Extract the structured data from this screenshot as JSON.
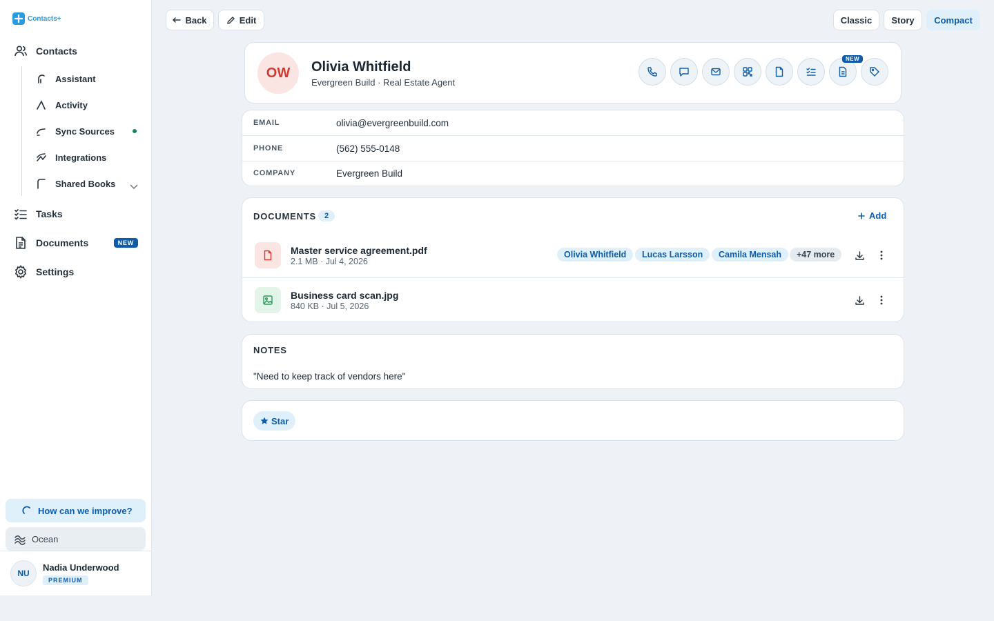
{
  "app": {
    "name": "Contacts+"
  },
  "sidebar": {
    "contacts_label": "Contacts",
    "sub_items": [
      {
        "label": "Assistant"
      },
      {
        "label": "Activity"
      },
      {
        "label": "Sync Sources"
      },
      {
        "label": "Integrations"
      },
      {
        "label": "Shared Books"
      }
    ],
    "tasks_label": "Tasks",
    "documents_label": "Documents",
    "documents_badge": "NEW",
    "settings_label": "Settings",
    "improve_label": "How can we improve?",
    "theme_label": "Ocean",
    "user": {
      "initials": "NU",
      "name": "Nadia Underwood",
      "plan": "PREMIUM"
    }
  },
  "toolbar": {
    "back_label": "Back",
    "edit_label": "Edit",
    "views": [
      {
        "label": "Classic",
        "active": false
      },
      {
        "label": "Story",
        "active": false
      },
      {
        "label": "Compact",
        "active": true
      }
    ]
  },
  "contact": {
    "initials": "OW",
    "name": "Olivia Whitfield",
    "subtitle": "Evergreen Build · Real Estate Agent",
    "actions": [
      "phone-icon",
      "chat-icon",
      "mail-icon",
      "qr-icon",
      "file-icon",
      "checklist-icon",
      "note-icon",
      "tag-icon"
    ],
    "new_flag": "NEW",
    "fields": [
      {
        "label": "EMAIL",
        "value": "olivia@evergreenbuild.com"
      },
      {
        "label": "PHONE",
        "value": "(562) 555-0148"
      },
      {
        "label": "COMPANY",
        "value": "Evergreen Build"
      }
    ]
  },
  "documents": {
    "title": "DOCUMENTS",
    "count": "2",
    "add_label": "Add",
    "items": [
      {
        "name": "Master service agreement.pdf",
        "meta": "2.1 MB · Jul 4, 2026",
        "type": "pdf",
        "shared_with": [
          "Olivia Whitfield",
          "Lucas Larsson",
          "Camila Mensah"
        ],
        "more": "+47 more"
      },
      {
        "name": "Business card scan.jpg",
        "meta": "840 KB · Jul 5, 2026",
        "type": "image"
      }
    ]
  },
  "notes": {
    "title": "NOTES",
    "text": "\"Need to keep track of vendors here\""
  },
  "star": {
    "label": "Star"
  },
  "colors": {
    "accent": "#0e5ca8",
    "brand": "#2a9be0",
    "pdf": "#cf3b32",
    "image": "#2a9a5c"
  }
}
